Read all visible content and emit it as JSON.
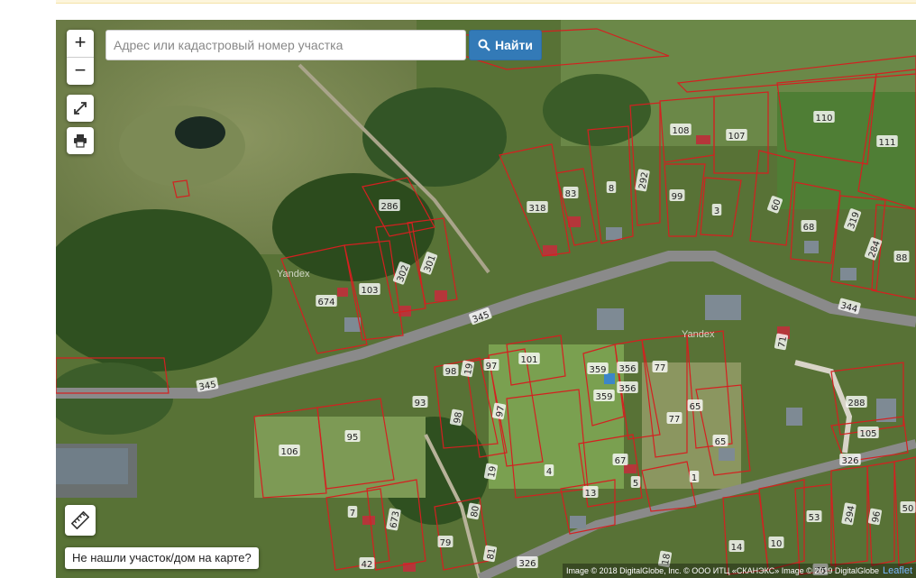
{
  "search": {
    "placeholder": "Адрес или кадастровый номер участка",
    "button_label": "Найти"
  },
  "controls": {
    "zoom_in": "+",
    "zoom_out": "−",
    "not_found_label": "Не нашли участок/дом на карте?"
  },
  "map": {
    "watermark": "Yandex",
    "attribution": "Image © 2018 DigitalGlobe, Inc. © ООО ИТЦ «СКАНЭКС» Image © 2019 DigitalGlobe",
    "attribution_link": "Leaflet",
    "parcel_labels": [
      "286",
      "318",
      "83",
      "8",
      "292",
      "108",
      "107",
      "110",
      "111",
      "99",
      "3",
      "60",
      "68",
      "319",
      "284",
      "88",
      "674",
      "103",
      "302",
      "301",
      "345",
      "345",
      "344",
      "71",
      "101",
      "98",
      "19",
      "97",
      "359",
      "356",
      "77",
      "93",
      "98",
      "97",
      "359",
      "356",
      "65",
      "77",
      "65",
      "288",
      "105",
      "106",
      "95",
      "4",
      "67",
      "5",
      "1",
      "326",
      "13",
      "7",
      "673",
      "80",
      "19",
      "294",
      "96",
      "50",
      "53",
      "10",
      "14",
      "42",
      "79",
      "81",
      "326",
      "18",
      "75"
    ],
    "colors": {
      "parcel_border": "#d42020",
      "road": "#8a8a8a"
    }
  }
}
